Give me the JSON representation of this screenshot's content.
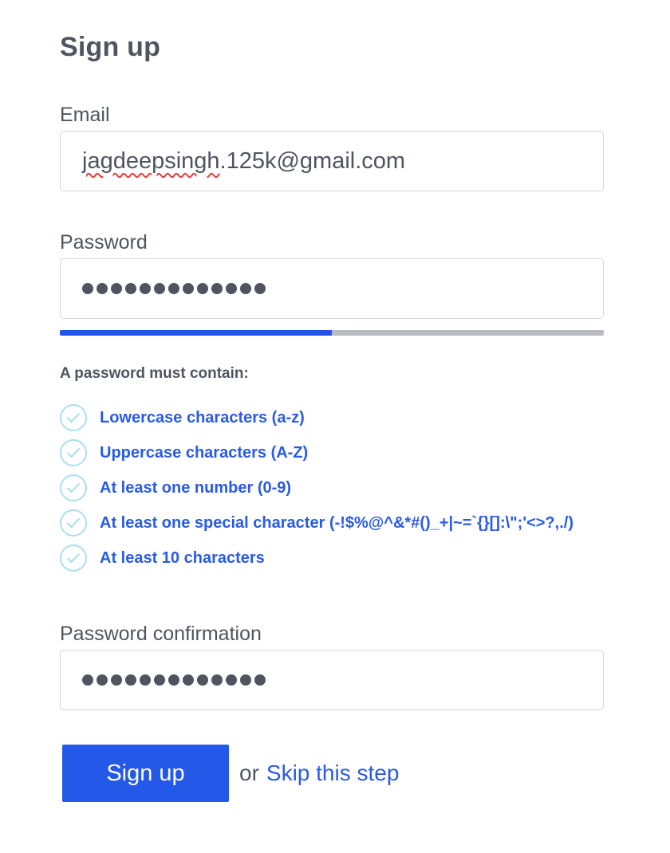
{
  "form": {
    "title": "Sign up",
    "email": {
      "label": "Email",
      "value_misspelled": "jagdeepsingh",
      "value_rest": ".125k@gmail.com"
    },
    "password": {
      "label": "Password",
      "masked_length": 13,
      "strength_fraction": 0.5
    },
    "requirements": {
      "heading": "A password must contain:",
      "items": [
        {
          "label": "Lowercase characters (a-z)",
          "met": true
        },
        {
          "label": "Uppercase characters (A-Z)",
          "met": true
        },
        {
          "label": "At least one number (0-9)",
          "met": true
        },
        {
          "label": "At least one special character (-!$%@^&*#()_+|~=`{}[]:\\\";'<>?,./)",
          "met": true
        },
        {
          "label": "At least 10 characters",
          "met": true
        }
      ],
      "icon": "check-circle-icon"
    },
    "password_confirmation": {
      "label": "Password confirmation",
      "masked_length": 13
    },
    "actions": {
      "submit_label": "Sign up",
      "or_text": "or",
      "skip_label": "Skip this step"
    }
  },
  "colors": {
    "accent": "#2458e8",
    "link": "#2a5be6",
    "text": "#4f5560",
    "check_ring": "#a9dff0",
    "strength_track": "#b8bbc0"
  }
}
